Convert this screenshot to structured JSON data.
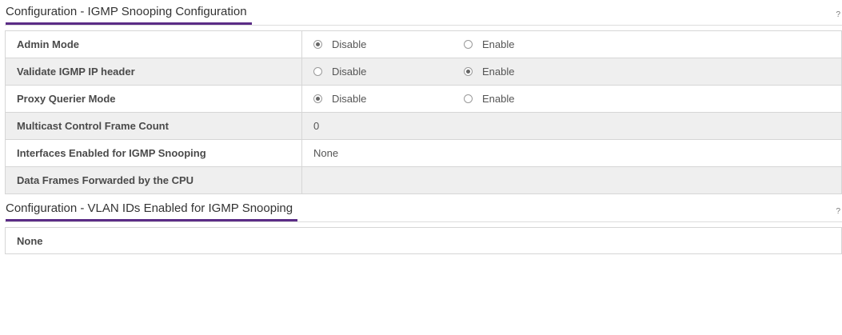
{
  "section1": {
    "title": "Configuration - IGMP Snooping Configuration",
    "help": "?"
  },
  "rows": {
    "admin_mode": {
      "label": "Admin Mode",
      "option1": "Disable",
      "option2": "Enable",
      "selected": "Disable"
    },
    "validate_ip_header": {
      "label": "Validate IGMP IP header",
      "option1": "Disable",
      "option2": "Enable",
      "selected": "Enable"
    },
    "proxy_querier_mode": {
      "label": "Proxy Querier Mode",
      "option1": "Disable",
      "option2": "Enable",
      "selected": "Disable"
    },
    "multicast_control_frame_count": {
      "label": "Multicast Control Frame Count",
      "value": "0"
    },
    "interfaces_enabled": {
      "label": "Interfaces Enabled for IGMP Snooping",
      "value": "None"
    },
    "data_frames_forwarded": {
      "label": "Data Frames Forwarded by the CPU",
      "value": ""
    }
  },
  "section2": {
    "title": "Configuration - VLAN IDs Enabled for IGMP Snooping",
    "help": "?",
    "value": "None"
  },
  "colors": {
    "accent": "#5b2c86",
    "alt_row": "#efefef",
    "border": "#d6d6d6"
  }
}
